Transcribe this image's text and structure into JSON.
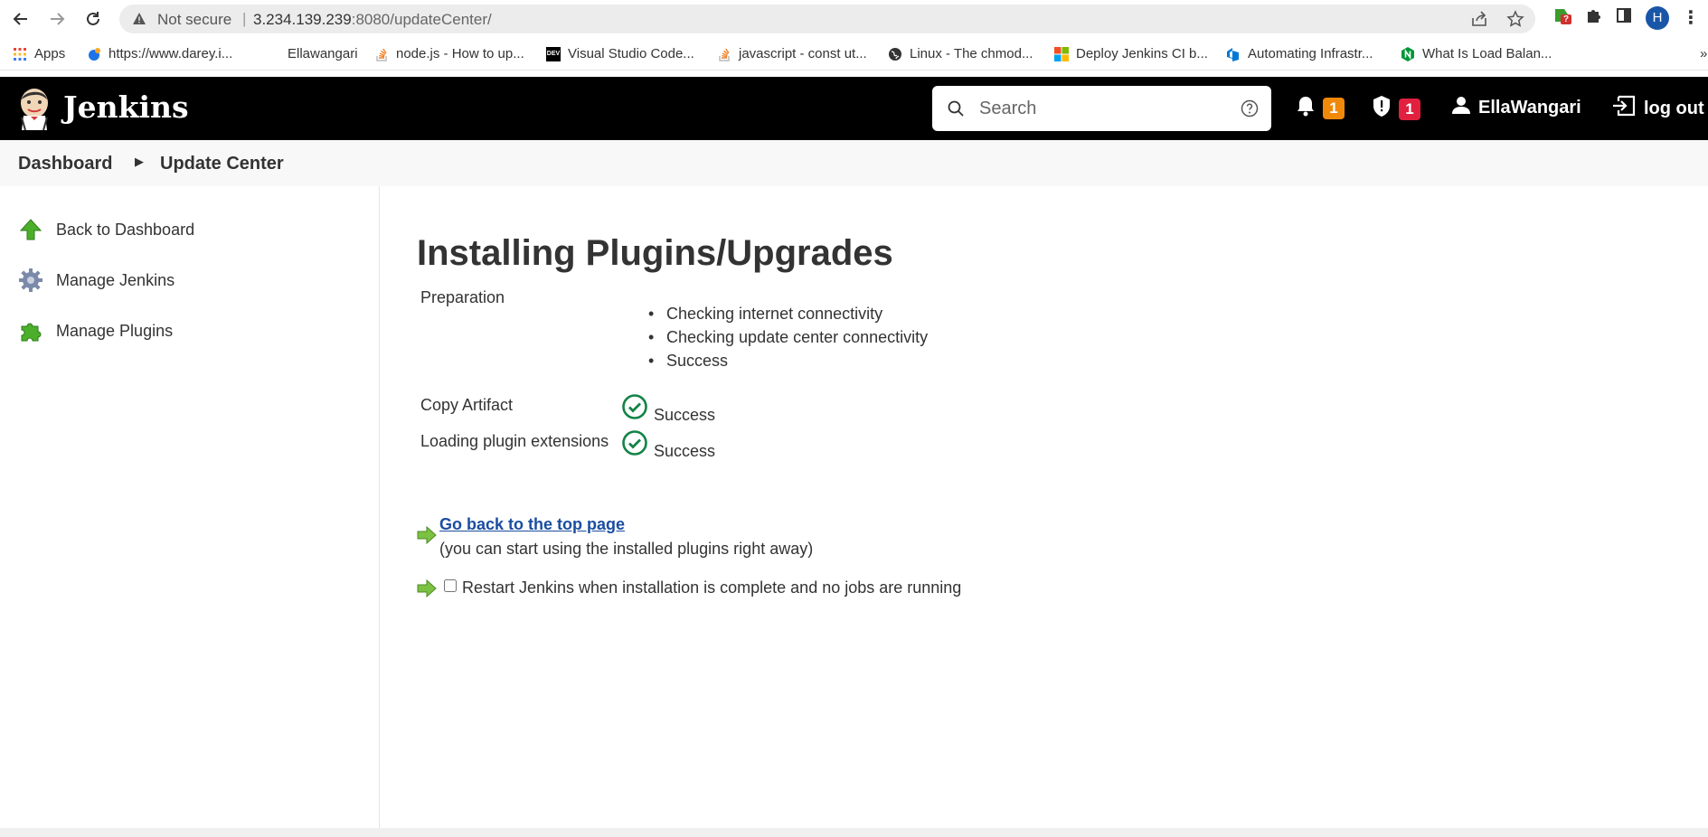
{
  "browser": {
    "security_label": "Not secure",
    "url_host": "3.234.139.239",
    "url_rest": ":8080/updateCenter/",
    "profile_initial": "H",
    "extension_badge": "?"
  },
  "bookmarks": [
    {
      "label": "Apps",
      "icon": "apps-grid-icon"
    },
    {
      "label": "https://www.darey.i...",
      "icon": "darey-icon"
    },
    {
      "label": "Ellawangari",
      "icon": ""
    },
    {
      "label": "node.js - How to up...",
      "icon": "stackoverflow-icon"
    },
    {
      "label": "Visual Studio Code...",
      "icon": "dev-icon"
    },
    {
      "label": "javascript - const ut...",
      "icon": "stackoverflow-icon"
    },
    {
      "label": "Linux - The chmod...",
      "icon": "globe-icon"
    },
    {
      "label": "Deploy Jenkins CI b...",
      "icon": "microsoft-icon"
    },
    {
      "label": "Automating Infrastr...",
      "icon": "azure-devops-icon"
    },
    {
      "label": "What Is Load Balan...",
      "icon": "nginx-icon"
    }
  ],
  "bookmarks_overflow": "»",
  "header": {
    "app_name": "Jenkins",
    "search_placeholder": "Search",
    "notifications_count": "1",
    "security_count": "1",
    "username": "EllaWangari",
    "logout_label": "log out"
  },
  "breadcrumb": {
    "items": [
      "Dashboard",
      "Update Center"
    ]
  },
  "sidebar": {
    "items": [
      {
        "label": "Back to Dashboard",
        "icon": "up-arrow-icon"
      },
      {
        "label": "Manage Jenkins",
        "icon": "gear-icon"
      },
      {
        "label": "Manage Plugins",
        "icon": "puzzle-icon"
      }
    ]
  },
  "main": {
    "title": "Installing Plugins/Upgrades",
    "preparation": {
      "label": "Preparation",
      "steps": [
        "Checking internet connectivity",
        "Checking update center connectivity",
        "Success"
      ]
    },
    "rows": [
      {
        "label": "Copy Artifact",
        "status": "Success"
      },
      {
        "label": "Loading plugin extensions",
        "status": "Success"
      }
    ],
    "top_link": "Go back to the top page",
    "top_link_note": "(you can start using the installed plugins right away)",
    "restart_label": "Restart Jenkins when installation is complete and no jobs are running",
    "restart_checked": false
  },
  "colors": {
    "header_bg": "#000000",
    "notif_badge": "#f0880a",
    "security_badge": "#e0203e",
    "success_green": "#138347",
    "link_blue": "#1a4da1"
  }
}
